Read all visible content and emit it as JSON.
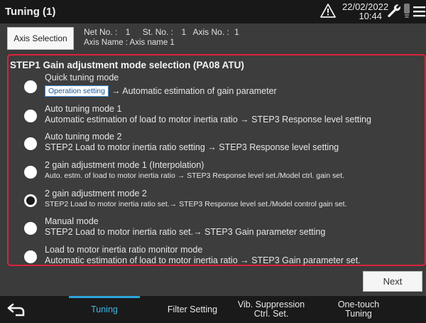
{
  "header": {
    "title": "Tuning (1)",
    "date": "22/02/2022",
    "time": "10:44",
    "icons": [
      "warning-icon",
      "wrench-icon",
      "bulb-icon",
      "menu-icon"
    ]
  },
  "axis": {
    "button_label": "Axis Selection",
    "net_no_label": "Net No. :",
    "net_no": "1",
    "st_no_label": "St. No. :",
    "st_no": "1",
    "axis_no_label": "Axis No. :",
    "axis_no": "1",
    "axis_name": "Axis Name : Axis name 1"
  },
  "step": {
    "title": "STEP1 Gain adjustment mode selection (PA08 ATU)",
    "selected_index": 4,
    "options": [
      {
        "label": "Quick tuning mode",
        "button": "Operation setting",
        "desc": "→ Automatic estimation of gain parameter"
      },
      {
        "label": "Auto tuning mode 1",
        "desc": "Automatic estimation of load to motor inertia ratio → STEP3 Response level setting"
      },
      {
        "label": "Auto tuning mode 2",
        "desc": "STEP2 Load to motor inertia ratio setting → STEP3 Response level setting"
      },
      {
        "label": "2 gain adjustment mode 1 (Interpolation)",
        "desc": "Auto. estm. of load to motor inertia ratio → STEP3 Response level set./Model ctrl. gain set."
      },
      {
        "label": "2 gain adjustment mode 2",
        "desc": "STEP2 Load to motor inertia ratio set.→ STEP3 Response level set./Model control gain set."
      },
      {
        "label": "Manual mode",
        "desc": "STEP2 Load to motor inertia ratio set.→ STEP3 Gain parameter setting"
      },
      {
        "label": "Load to motor inertia ratio monitor mode",
        "desc": "Automatic estimation of load to motor inertia ratio → STEP3 Gain parameter set."
      }
    ]
  },
  "next_label": "Next",
  "nav": {
    "back_icon": "back-arrow-icon",
    "tabs": [
      {
        "label": "Tuning",
        "active": true
      },
      {
        "label": "Filter Setting",
        "active": false
      },
      {
        "label": "Vib. Suppression Ctrl. Set.",
        "label_lines": [
          "Vib. Suppression",
          "Ctrl. Set."
        ],
        "active": false
      },
      {
        "label": "One-touch Tuning",
        "label_lines": [
          "One-touch",
          "Tuning"
        ],
        "active": false
      }
    ]
  },
  "colors": {
    "accent_red": "#d9243a",
    "tab_active": "#3fb7e8",
    "background": "#3b3b3b"
  }
}
